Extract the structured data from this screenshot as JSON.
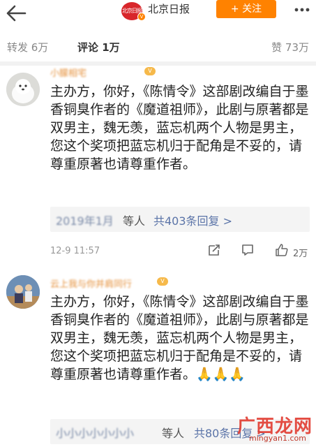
{
  "header": {
    "logo_text": "北京日报",
    "account_name": "北京日报",
    "follow_label": "+ 关注",
    "icons": {
      "back": "arrow-left-icon",
      "more": "more-dots-icon",
      "verified": "verified-v-icon"
    }
  },
  "tabs": {
    "repost": "转发 6万",
    "comment": "评论 1万",
    "like": "赞 73万"
  },
  "comments": [
    {
      "username": "小朦相宅",
      "medal": "V",
      "text": "主办方，你好，《陈情令》这部剧改编自于墨香铜臭作者的《魔道祖师》，此剧与原著都是双男主，魏无羡，蓝忘机两个人物是男主，您这个奖项把蓝忘机归于配角是不妥的，请尊重原著也请尊重作者。",
      "reply_names": "2019年1月",
      "reply_suffix": "等人",
      "reply_count": "共403条回复 >",
      "time": "12-9 11:57",
      "like_count": "2万"
    },
    {
      "username": "云上我与你并肩同行",
      "medal": "V",
      "text": "主办方，你好，《陈情令》这部剧改编自于墨香铜臭作者的《魔道祖师》，此剧与原著都是双男主，魏无羡，蓝忘机两个人物是男主，您这个奖项把蓝忘机归于配角是不妥的，请尊重原著也请尊重作者。🙏🙏🙏",
      "reply_names": "小小小小小小小",
      "reply_suffix": "等人",
      "reply_count": "共80条回复 >"
    }
  ],
  "watermark": {
    "logo": "广西龙网",
    "url": "mingyan1.com"
  }
}
